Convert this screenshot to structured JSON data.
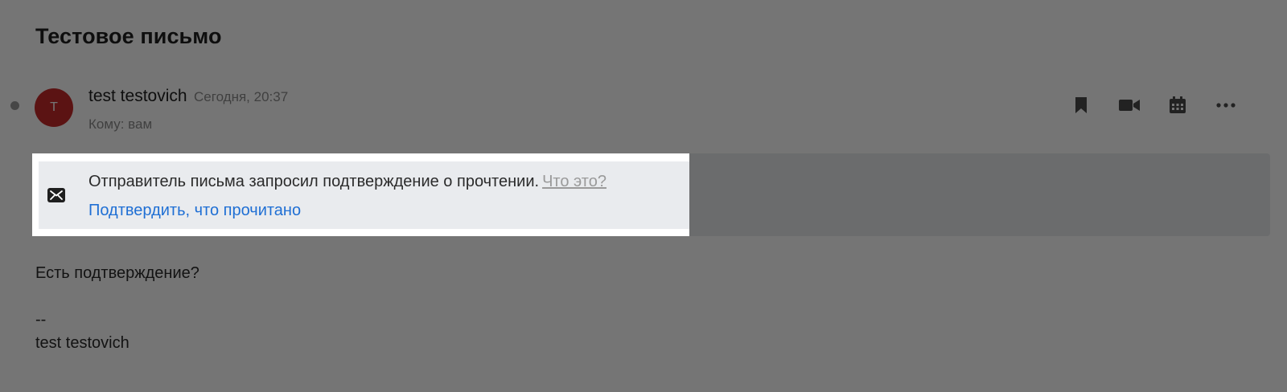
{
  "message": {
    "subject": "Тестовое письмо",
    "sender": {
      "avatar_letter": "T",
      "name": "test testovich",
      "time": "Сегодня, 20:37",
      "recipient": "Кому: вам"
    },
    "read_receipt": {
      "text": "Отправитель письма запросил подтверждение о прочтении.",
      "what_link": "Что это?",
      "confirm_link": "Подтвердить, что прочитано"
    },
    "body": {
      "line1": "Есть подтверждение?",
      "signature_separator": "--",
      "signature": "test testovich"
    }
  },
  "toolbar": {
    "icons": [
      "bookmark-icon",
      "video-icon",
      "calendar-icon",
      "more-icon"
    ]
  },
  "colors": {
    "avatar": "#c62a2a",
    "link": "#1f6fd4",
    "notice_background": "#e9ebee",
    "overlay": "rgba(0,0,0,0.54)"
  }
}
